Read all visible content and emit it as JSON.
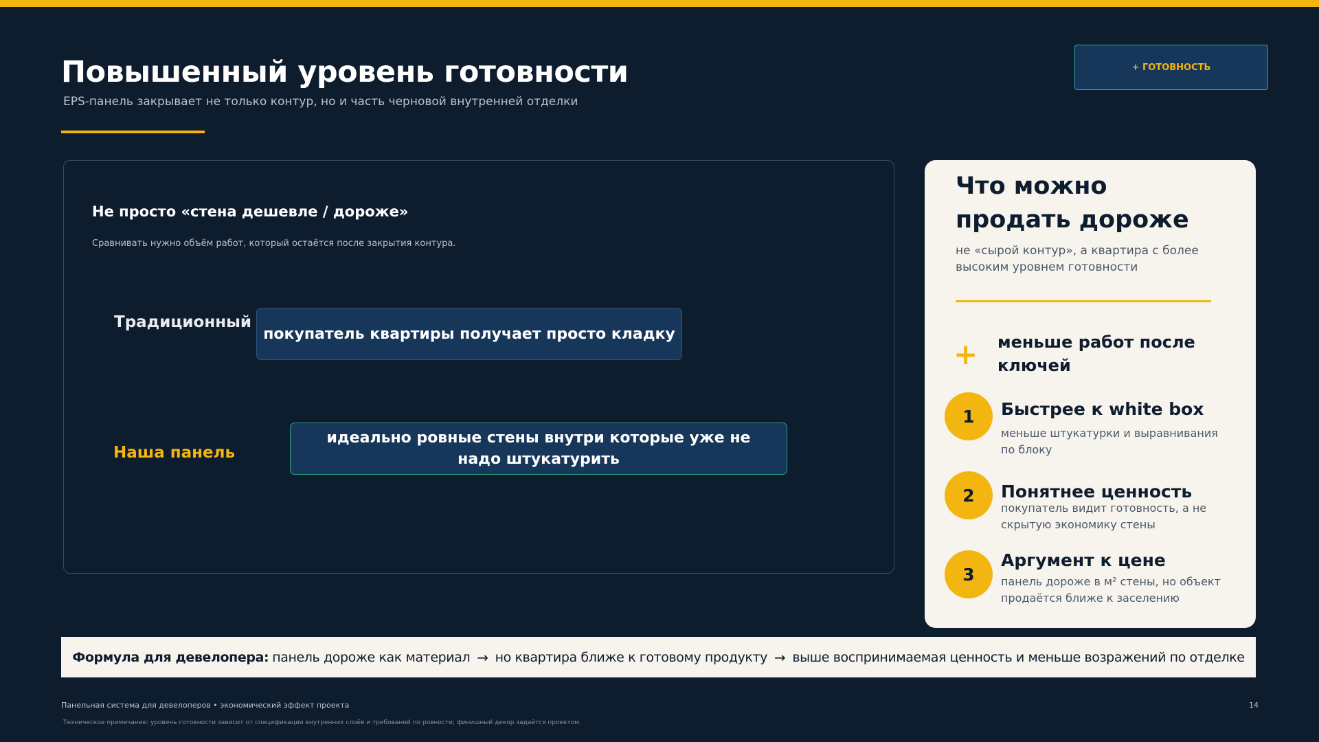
{
  "header": {
    "title": "Повышенный уровень готовности",
    "subtitle": "EPS-панель закрывает не только контур, но и часть черновой внутренней отделки",
    "badge": "+ ГОТОВНОСТЬ"
  },
  "comparison": {
    "heading": "Не просто «стена дешевле / дороже»",
    "subheading": "Сравнивать нужно объём работ, который  остаётся после  закрытия контура.",
    "rows": [
      {
        "label": "Традиционный блок",
        "text": "покупатель квартиры получает просто кладку"
      },
      {
        "label": "Наша панель",
        "text": "идеально ровные стены внутри которые уже не надо штукатурить"
      }
    ]
  },
  "side": {
    "title": "Что можно продать дороже",
    "subtitle": "не «сырой контур», а квартира с более высоким уровнем готовности",
    "plus_icon": "+",
    "plus_text": "меньше работ после ключей",
    "items": [
      {
        "num": "1",
        "title": "Быстрее к white box",
        "desc": "меньше штукатурки и выравнивания  по блоку"
      },
      {
        "num": "2",
        "title": "Понятнее ценность",
        "desc": "покупатель видит готовность, а не скрытую экономику стены"
      },
      {
        "num": "3",
        "title": "Аргумент к цене",
        "desc": "панель дороже в м² стены, но объект продаётся ближе к заселению"
      }
    ]
  },
  "formula": {
    "lead": "Формула для девелопера:",
    "parts": [
      "панель дороже как материал",
      "но квартира ближе к готовому продукту",
      "выше воспринимаемая ценность и меньше возражений по отделке"
    ],
    "arrow": "→"
  },
  "footer": {
    "left": "Панельная система для девелоперов • экономический эффект проекта",
    "page": "14",
    "note": "Техническое примечание: уровень готовности зависит от спецификации внутренних слоёв и требований по ровности; финишный декор задаётся проектом."
  },
  "colors": {
    "background": "#0e1d2e",
    "accent": "#f3b510",
    "card": "#f7f3ed",
    "pill": "#16365a",
    "teal": "#2ba6a9"
  }
}
